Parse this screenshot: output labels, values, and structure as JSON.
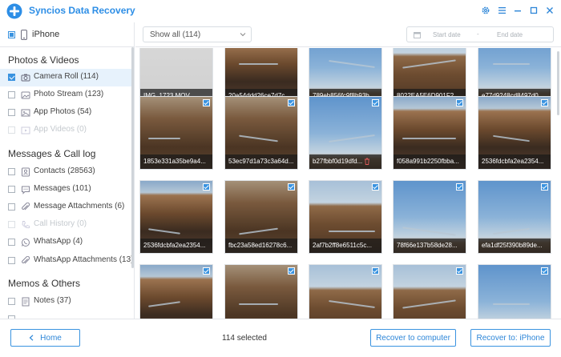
{
  "app": {
    "title": "Syncios Data Recovery"
  },
  "device": {
    "name": "iPhone"
  },
  "sidebar": {
    "sections": [
      {
        "title": "Photos & Videos",
        "items": [
          {
            "label": "Camera Roll (114)",
            "state": "checked",
            "icon": "camera-icon",
            "active": true
          },
          {
            "label": "Photo Stream (123)",
            "state": "unchecked",
            "icon": "photo-stream-icon"
          },
          {
            "label": "App Photos (54)",
            "state": "unchecked",
            "icon": "image-icon"
          },
          {
            "label": "App Videos (0)",
            "state": "disabled",
            "icon": "video-icon"
          }
        ]
      },
      {
        "title": "Messages & Call log",
        "items": [
          {
            "label": "Contacts (28563)",
            "state": "unchecked",
            "icon": "contacts-icon"
          },
          {
            "label": "Messages (101)",
            "state": "unchecked",
            "icon": "message-icon"
          },
          {
            "label": "Message Attachments (6)",
            "state": "unchecked",
            "icon": "paperclip-icon"
          },
          {
            "label": "Call History (0)",
            "state": "disabled",
            "icon": "phone-icon"
          },
          {
            "label": "WhatsApp (4)",
            "state": "unchecked",
            "icon": "whatsapp-icon"
          },
          {
            "label": "WhatsApp Attachments (13)",
            "state": "unchecked",
            "icon": "paperclip-icon"
          }
        ]
      },
      {
        "title": "Memos & Others",
        "items": [
          {
            "label": "Notes (37)",
            "state": "unchecked",
            "icon": "notes-icon"
          }
        ]
      }
    ]
  },
  "toolbar": {
    "filter": "Show all (114)",
    "start_date": "Start date",
    "date_separator": "-",
    "end_date": "End date"
  },
  "grid": {
    "rows": [
      [
        {
          "name": "IMG_1723.MOV",
          "photo": "gray"
        },
        {
          "name": "20a54ddd26ce7d7c...",
          "photo": "river"
        },
        {
          "name": "789eb856fc9f8b93b...",
          "photo": "sky"
        },
        {
          "name": "8022EA5E6D901F2...",
          "photo": "river2"
        },
        {
          "name": "e77d9248cd8497d0...",
          "photo": "sky"
        }
      ],
      [
        {
          "name": "1853e331a35be9a4...",
          "photo": "dark"
        },
        {
          "name": "53ec97d1a73c3a64d...",
          "photo": "dark"
        },
        {
          "name": "b27fbbf0d19dfd...",
          "photo": "sky",
          "trash": true
        },
        {
          "name": "f058a991b2250fbba...",
          "photo": "river"
        },
        {
          "name": "2536fdcbfa2ea2354...",
          "photo": "river"
        }
      ],
      [
        {
          "name": "2536fdcbfa2ea2354...",
          "photo": "river"
        },
        {
          "name": "fbc23a58ed16278c6...",
          "photo": "dark"
        },
        {
          "name": "2af7b2ff8e6511c5c...",
          "photo": "river2"
        },
        {
          "name": "78f66e137b58de28...",
          "photo": "sky"
        },
        {
          "name": "efa1df25f390b89de...",
          "photo": "sky"
        }
      ],
      [
        {
          "name": "",
          "photo": "river"
        },
        {
          "name": "",
          "photo": "dark"
        },
        {
          "name": "",
          "photo": "river2"
        },
        {
          "name": "",
          "photo": "river2"
        },
        {
          "name": "",
          "photo": "sky"
        }
      ]
    ]
  },
  "footer": {
    "home": "Home",
    "selected": "114 selected",
    "recover_computer": "Recover to computer",
    "recover_device": "Recover to: iPhone"
  },
  "colors": {
    "accent": "#3a93e0",
    "title": "#2d8ee6"
  }
}
